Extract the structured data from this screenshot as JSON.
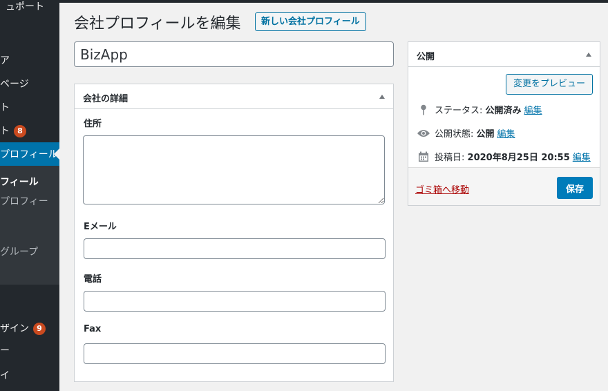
{
  "sidebar": {
    "items": [
      {
        "label": "ュポート"
      },
      {
        "label": "ア"
      },
      {
        "label": "ページ"
      },
      {
        "label": "ト"
      },
      {
        "label": "ト",
        "badge": "8"
      },
      {
        "label": "プロフィール"
      },
      {
        "label": "ザイン",
        "badge": "9"
      },
      {
        "label": "ー"
      },
      {
        "label": "イ"
      }
    ],
    "submenu": [
      {
        "label": "フィール"
      },
      {
        "label": "プロフィー"
      },
      {
        "label": "グループ"
      }
    ]
  },
  "header": {
    "title": "会社プロフィールを編集",
    "add_new_label": "新しい会社プロフィール"
  },
  "post_title": {
    "value": "BizApp"
  },
  "details": {
    "title": "会社の詳細",
    "fields": [
      {
        "label": "住所",
        "value": ""
      },
      {
        "label": "Eメール",
        "value": ""
      },
      {
        "label": "電話",
        "value": ""
      },
      {
        "label": "Fax",
        "value": ""
      }
    ]
  },
  "publish": {
    "title": "公開",
    "preview_label": "変更をプレビュー",
    "status_label": "ステータス:",
    "status_value": "公開済み",
    "visibility_label": "公開状態:",
    "visibility_value": "公開",
    "date_label": "投稿日:",
    "date_value": "2020年8月25日 20:55",
    "edit_label": "編集",
    "trash_label": "ゴミ箱へ移動",
    "save_label": "保存"
  },
  "colors": {
    "accent": "#0073aa",
    "sidebar_bg": "#23282d",
    "badge": "#ca4a1f",
    "trash": "#aa0000"
  }
}
